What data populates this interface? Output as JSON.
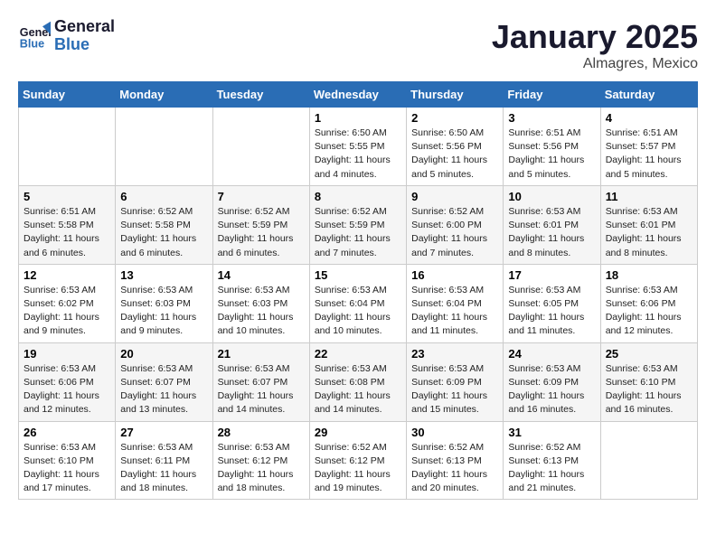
{
  "header": {
    "logo_line1": "General",
    "logo_line2": "Blue",
    "title": "January 2025",
    "subtitle": "Almagres, Mexico"
  },
  "days_of_week": [
    "Sunday",
    "Monday",
    "Tuesday",
    "Wednesday",
    "Thursday",
    "Friday",
    "Saturday"
  ],
  "weeks": [
    [
      {
        "day": "",
        "info": ""
      },
      {
        "day": "",
        "info": ""
      },
      {
        "day": "",
        "info": ""
      },
      {
        "day": "1",
        "info": "Sunrise: 6:50 AM\nSunset: 5:55 PM\nDaylight: 11 hours\nand 4 minutes."
      },
      {
        "day": "2",
        "info": "Sunrise: 6:50 AM\nSunset: 5:56 PM\nDaylight: 11 hours\nand 5 minutes."
      },
      {
        "day": "3",
        "info": "Sunrise: 6:51 AM\nSunset: 5:56 PM\nDaylight: 11 hours\nand 5 minutes."
      },
      {
        "day": "4",
        "info": "Sunrise: 6:51 AM\nSunset: 5:57 PM\nDaylight: 11 hours\nand 5 minutes."
      }
    ],
    [
      {
        "day": "5",
        "info": "Sunrise: 6:51 AM\nSunset: 5:58 PM\nDaylight: 11 hours\nand 6 minutes."
      },
      {
        "day": "6",
        "info": "Sunrise: 6:52 AM\nSunset: 5:58 PM\nDaylight: 11 hours\nand 6 minutes."
      },
      {
        "day": "7",
        "info": "Sunrise: 6:52 AM\nSunset: 5:59 PM\nDaylight: 11 hours\nand 6 minutes."
      },
      {
        "day": "8",
        "info": "Sunrise: 6:52 AM\nSunset: 5:59 PM\nDaylight: 11 hours\nand 7 minutes."
      },
      {
        "day": "9",
        "info": "Sunrise: 6:52 AM\nSunset: 6:00 PM\nDaylight: 11 hours\nand 7 minutes."
      },
      {
        "day": "10",
        "info": "Sunrise: 6:53 AM\nSunset: 6:01 PM\nDaylight: 11 hours\nand 8 minutes."
      },
      {
        "day": "11",
        "info": "Sunrise: 6:53 AM\nSunset: 6:01 PM\nDaylight: 11 hours\nand 8 minutes."
      }
    ],
    [
      {
        "day": "12",
        "info": "Sunrise: 6:53 AM\nSunset: 6:02 PM\nDaylight: 11 hours\nand 9 minutes."
      },
      {
        "day": "13",
        "info": "Sunrise: 6:53 AM\nSunset: 6:03 PM\nDaylight: 11 hours\nand 9 minutes."
      },
      {
        "day": "14",
        "info": "Sunrise: 6:53 AM\nSunset: 6:03 PM\nDaylight: 11 hours\nand 10 minutes."
      },
      {
        "day": "15",
        "info": "Sunrise: 6:53 AM\nSunset: 6:04 PM\nDaylight: 11 hours\nand 10 minutes."
      },
      {
        "day": "16",
        "info": "Sunrise: 6:53 AM\nSunset: 6:04 PM\nDaylight: 11 hours\nand 11 minutes."
      },
      {
        "day": "17",
        "info": "Sunrise: 6:53 AM\nSunset: 6:05 PM\nDaylight: 11 hours\nand 11 minutes."
      },
      {
        "day": "18",
        "info": "Sunrise: 6:53 AM\nSunset: 6:06 PM\nDaylight: 11 hours\nand 12 minutes."
      }
    ],
    [
      {
        "day": "19",
        "info": "Sunrise: 6:53 AM\nSunset: 6:06 PM\nDaylight: 11 hours\nand 12 minutes."
      },
      {
        "day": "20",
        "info": "Sunrise: 6:53 AM\nSunset: 6:07 PM\nDaylight: 11 hours\nand 13 minutes."
      },
      {
        "day": "21",
        "info": "Sunrise: 6:53 AM\nSunset: 6:07 PM\nDaylight: 11 hours\nand 14 minutes."
      },
      {
        "day": "22",
        "info": "Sunrise: 6:53 AM\nSunset: 6:08 PM\nDaylight: 11 hours\nand 14 minutes."
      },
      {
        "day": "23",
        "info": "Sunrise: 6:53 AM\nSunset: 6:09 PM\nDaylight: 11 hours\nand 15 minutes."
      },
      {
        "day": "24",
        "info": "Sunrise: 6:53 AM\nSunset: 6:09 PM\nDaylight: 11 hours\nand 16 minutes."
      },
      {
        "day": "25",
        "info": "Sunrise: 6:53 AM\nSunset: 6:10 PM\nDaylight: 11 hours\nand 16 minutes."
      }
    ],
    [
      {
        "day": "26",
        "info": "Sunrise: 6:53 AM\nSunset: 6:10 PM\nDaylight: 11 hours\nand 17 minutes."
      },
      {
        "day": "27",
        "info": "Sunrise: 6:53 AM\nSunset: 6:11 PM\nDaylight: 11 hours\nand 18 minutes."
      },
      {
        "day": "28",
        "info": "Sunrise: 6:53 AM\nSunset: 6:12 PM\nDaylight: 11 hours\nand 18 minutes."
      },
      {
        "day": "29",
        "info": "Sunrise: 6:52 AM\nSunset: 6:12 PM\nDaylight: 11 hours\nand 19 minutes."
      },
      {
        "day": "30",
        "info": "Sunrise: 6:52 AM\nSunset: 6:13 PM\nDaylight: 11 hours\nand 20 minutes."
      },
      {
        "day": "31",
        "info": "Sunrise: 6:52 AM\nSunset: 6:13 PM\nDaylight: 11 hours\nand 21 minutes."
      },
      {
        "day": "",
        "info": ""
      }
    ]
  ]
}
